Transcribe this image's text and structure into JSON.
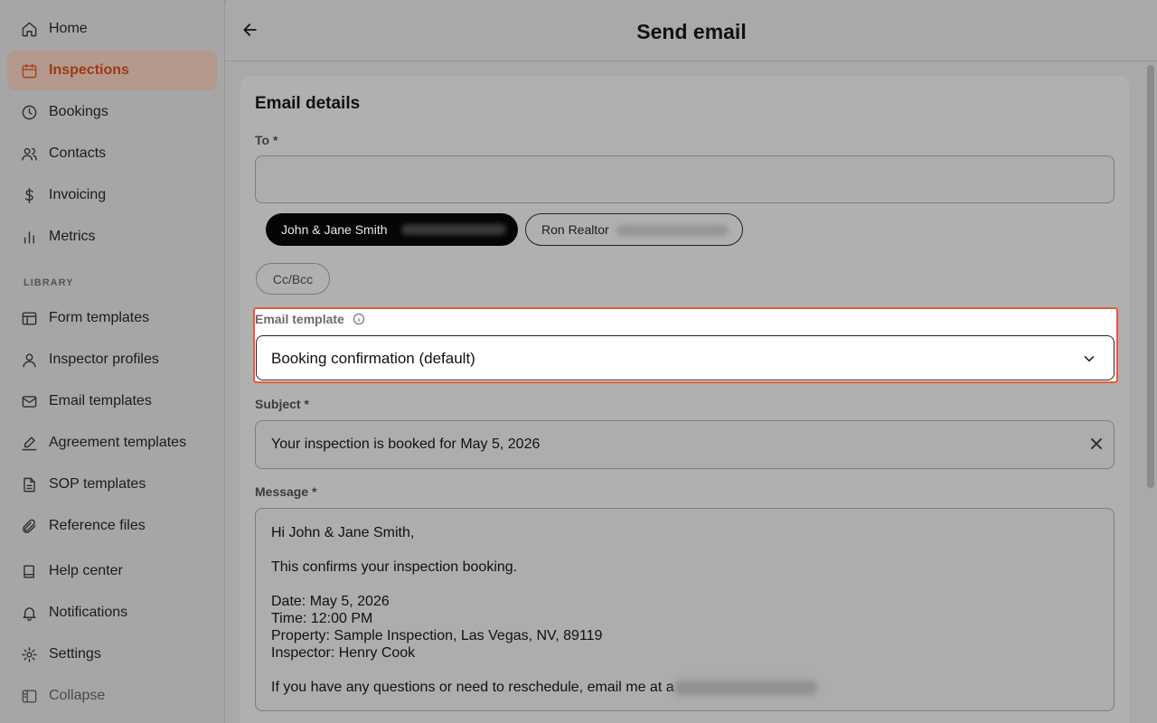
{
  "sidebar": {
    "items": [
      {
        "label": "Home",
        "icon": "home-icon"
      },
      {
        "label": "Inspections",
        "icon": "calendar-icon"
      },
      {
        "label": "Bookings",
        "icon": "clock-icon"
      },
      {
        "label": "Contacts",
        "icon": "users-icon"
      },
      {
        "label": "Invoicing",
        "icon": "dollar-icon"
      },
      {
        "label": "Metrics",
        "icon": "bar-chart-icon"
      }
    ],
    "section_label": "LIBRARY",
    "library_items": [
      {
        "label": "Form templates",
        "icon": "layout-icon"
      },
      {
        "label": "Inspector profiles",
        "icon": "user-icon"
      },
      {
        "label": "Email templates",
        "icon": "mail-icon"
      },
      {
        "label": "Agreement templates",
        "icon": "signature-icon"
      },
      {
        "label": "SOP templates",
        "icon": "file-icon"
      },
      {
        "label": "Reference files",
        "icon": "paperclip-icon"
      }
    ],
    "footer_items": [
      {
        "label": "Help center",
        "icon": "book-icon"
      },
      {
        "label": "Notifications",
        "icon": "bell-icon"
      },
      {
        "label": "Settings",
        "icon": "gear-icon"
      },
      {
        "label": "Collapse",
        "icon": "collapse-icon"
      }
    ],
    "active": "Inspections"
  },
  "header": {
    "title": "Send email",
    "back_icon": "arrow-left-icon"
  },
  "card": {
    "title": "Email details",
    "to_label": "To *",
    "to_value": "",
    "recipients": [
      {
        "name": "John & Jane Smith",
        "selected": true
      },
      {
        "name": "Ron Realtor",
        "selected": false
      }
    ],
    "cc_bcc_label": "Cc/Bcc",
    "template_label": "Email template",
    "template_value": "Booking confirmation (default)",
    "subject_label": "Subject *",
    "subject_value": "Your inspection is booked for May 5, 2026",
    "message_label": "Message *",
    "message": {
      "greeting": "Hi John & Jane Smith,",
      "line1": "This confirms your inspection booking.",
      "date": "Date: May 5, 2026",
      "time": "Time: 12:00 PM",
      "property": "Property: Sample Inspection, Las Vegas, NV, 89119",
      "inspector": "Inspector: Henry Cook",
      "closing": "If you have any questions or need to reschedule, email me at a"
    }
  },
  "colors": {
    "accent": "#a8441a",
    "highlight_border": "#e8593b",
    "active_bg": "#b4998e"
  }
}
